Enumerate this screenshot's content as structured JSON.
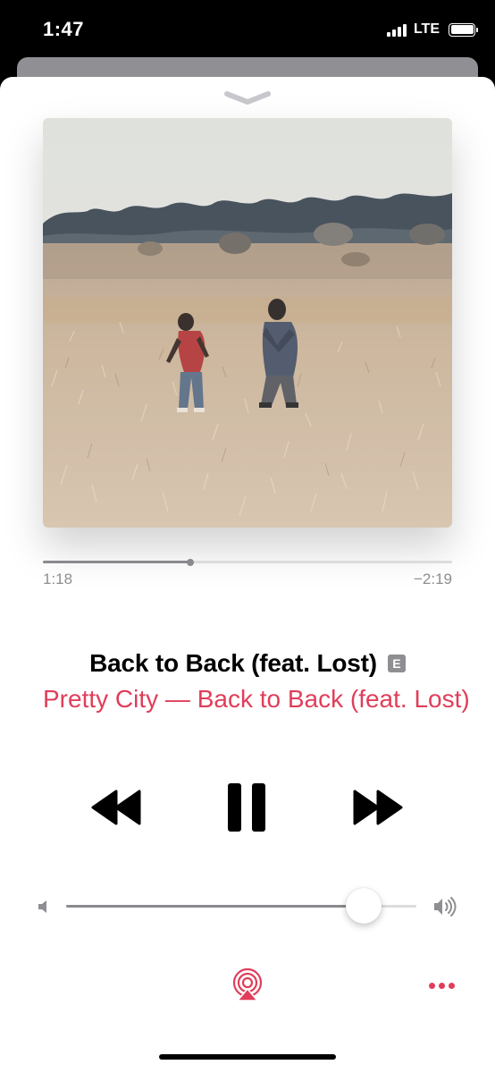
{
  "status_bar": {
    "time": "1:47",
    "network": "LTE",
    "signal_bars": 4,
    "battery_level": 1.0
  },
  "now_playing": {
    "artwork_icon": "album-artwork-field-photo",
    "elapsed": "1:18",
    "remaining": "−2:19",
    "progress_fraction": 0.36,
    "title": "Back to Back (feat. Lost)",
    "explicit_badge": "E",
    "subtitle": "Pretty City — Back to Back (feat. Lost)"
  },
  "controls": {
    "rewind_icon": "rewind-icon",
    "pause_icon": "pause-icon",
    "forward_icon": "fast-forward-icon"
  },
  "volume": {
    "level_fraction": 0.85,
    "low_icon": "volume-low-icon",
    "high_icon": "volume-high-icon"
  },
  "bottom": {
    "airplay_icon": "airplay-icon",
    "more_icon": "more-icon"
  },
  "colors": {
    "accent": "#e03e5a",
    "secondary_text": "#8e8e93",
    "track": "#dcdcdc",
    "track_fill": "#8a8a8e"
  }
}
